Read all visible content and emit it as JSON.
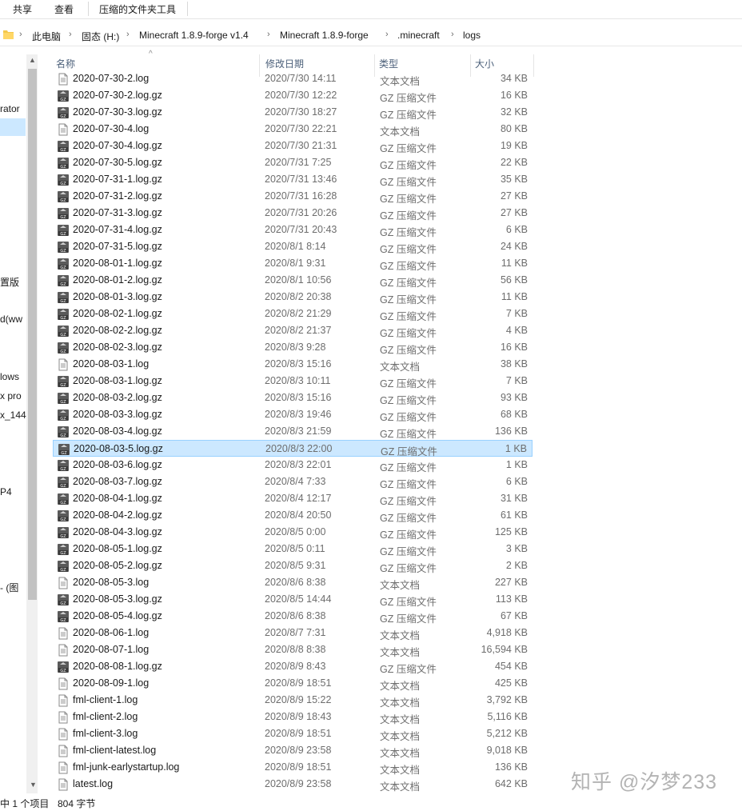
{
  "ribbon": {
    "tabs": [
      "共享",
      "查看",
      "压缩的文件夹工具"
    ]
  },
  "address": {
    "crumbs": [
      "此电脑",
      "固态 (H:)",
      "Minecraft 1.8.9-forge v1.4",
      "Minecraft 1.8.9-forge",
      ".minecraft",
      "logs"
    ]
  },
  "nav": {
    "fragments": [
      "rator",
      "置版",
      "d(ww",
      "lows",
      "x pro",
      "x_144",
      "P4",
      "- (图"
    ]
  },
  "columns": {
    "name": "名称",
    "date": "修改日期",
    "type": "类型",
    "size": "大小"
  },
  "files": [
    {
      "name": "2020-07-30-2.log",
      "date": "2020/7/30 14:11",
      "type": "文本文档",
      "size": "34 KB",
      "icon": "text-file-icon"
    },
    {
      "name": "2020-07-30-2.log.gz",
      "date": "2020/7/30 12:22",
      "type": "GZ 压缩文件",
      "size": "16 KB",
      "icon": "gz-file-icon"
    },
    {
      "name": "2020-07-30-3.log.gz",
      "date": "2020/7/30 18:27",
      "type": "GZ 压缩文件",
      "size": "32 KB",
      "icon": "gz-file-icon"
    },
    {
      "name": "2020-07-30-4.log",
      "date": "2020/7/30 22:21",
      "type": "文本文档",
      "size": "80 KB",
      "icon": "text-file-icon"
    },
    {
      "name": "2020-07-30-4.log.gz",
      "date": "2020/7/30 21:31",
      "type": "GZ 压缩文件",
      "size": "19 KB",
      "icon": "gz-file-icon"
    },
    {
      "name": "2020-07-30-5.log.gz",
      "date": "2020/7/31 7:25",
      "type": "GZ 压缩文件",
      "size": "22 KB",
      "icon": "gz-file-icon"
    },
    {
      "name": "2020-07-31-1.log.gz",
      "date": "2020/7/31 13:46",
      "type": "GZ 压缩文件",
      "size": "35 KB",
      "icon": "gz-file-icon"
    },
    {
      "name": "2020-07-31-2.log.gz",
      "date": "2020/7/31 16:28",
      "type": "GZ 压缩文件",
      "size": "27 KB",
      "icon": "gz-file-icon"
    },
    {
      "name": "2020-07-31-3.log.gz",
      "date": "2020/7/31 20:26",
      "type": "GZ 压缩文件",
      "size": "27 KB",
      "icon": "gz-file-icon"
    },
    {
      "name": "2020-07-31-4.log.gz",
      "date": "2020/7/31 20:43",
      "type": "GZ 压缩文件",
      "size": "6 KB",
      "icon": "gz-file-icon"
    },
    {
      "name": "2020-07-31-5.log.gz",
      "date": "2020/8/1 8:14",
      "type": "GZ 压缩文件",
      "size": "24 KB",
      "icon": "gz-file-icon"
    },
    {
      "name": "2020-08-01-1.log.gz",
      "date": "2020/8/1 9:31",
      "type": "GZ 压缩文件",
      "size": "11 KB",
      "icon": "gz-file-icon"
    },
    {
      "name": "2020-08-01-2.log.gz",
      "date": "2020/8/1 10:56",
      "type": "GZ 压缩文件",
      "size": "56 KB",
      "icon": "gz-file-icon"
    },
    {
      "name": "2020-08-01-3.log.gz",
      "date": "2020/8/2 20:38",
      "type": "GZ 压缩文件",
      "size": "11 KB",
      "icon": "gz-file-icon"
    },
    {
      "name": "2020-08-02-1.log.gz",
      "date": "2020/8/2 21:29",
      "type": "GZ 压缩文件",
      "size": "7 KB",
      "icon": "gz-file-icon"
    },
    {
      "name": "2020-08-02-2.log.gz",
      "date": "2020/8/2 21:37",
      "type": "GZ 压缩文件",
      "size": "4 KB",
      "icon": "gz-file-icon"
    },
    {
      "name": "2020-08-02-3.log.gz",
      "date": "2020/8/3 9:28",
      "type": "GZ 压缩文件",
      "size": "16 KB",
      "icon": "gz-file-icon"
    },
    {
      "name": "2020-08-03-1.log",
      "date": "2020/8/3 15:16",
      "type": "文本文档",
      "size": "38 KB",
      "icon": "text-file-icon"
    },
    {
      "name": "2020-08-03-1.log.gz",
      "date": "2020/8/3 10:11",
      "type": "GZ 压缩文件",
      "size": "7 KB",
      "icon": "gz-file-icon"
    },
    {
      "name": "2020-08-03-2.log.gz",
      "date": "2020/8/3 15:16",
      "type": "GZ 压缩文件",
      "size": "93 KB",
      "icon": "gz-file-icon"
    },
    {
      "name": "2020-08-03-3.log.gz",
      "date": "2020/8/3 19:46",
      "type": "GZ 压缩文件",
      "size": "68 KB",
      "icon": "gz-file-icon"
    },
    {
      "name": "2020-08-03-4.log.gz",
      "date": "2020/8/3 21:59",
      "type": "GZ 压缩文件",
      "size": "136 KB",
      "icon": "gz-file-icon"
    },
    {
      "name": "2020-08-03-5.log.gz",
      "date": "2020/8/3 22:00",
      "type": "GZ 压缩文件",
      "size": "1 KB",
      "icon": "gz-file-icon",
      "selected": true
    },
    {
      "name": "2020-08-03-6.log.gz",
      "date": "2020/8/3 22:01",
      "type": "GZ 压缩文件",
      "size": "1 KB",
      "icon": "gz-file-icon"
    },
    {
      "name": "2020-08-03-7.log.gz",
      "date": "2020/8/4 7:33",
      "type": "GZ 压缩文件",
      "size": "6 KB",
      "icon": "gz-file-icon"
    },
    {
      "name": "2020-08-04-1.log.gz",
      "date": "2020/8/4 12:17",
      "type": "GZ 压缩文件",
      "size": "31 KB",
      "icon": "gz-file-icon"
    },
    {
      "name": "2020-08-04-2.log.gz",
      "date": "2020/8/4 20:50",
      "type": "GZ 压缩文件",
      "size": "61 KB",
      "icon": "gz-file-icon"
    },
    {
      "name": "2020-08-04-3.log.gz",
      "date": "2020/8/5 0:00",
      "type": "GZ 压缩文件",
      "size": "125 KB",
      "icon": "gz-file-icon"
    },
    {
      "name": "2020-08-05-1.log.gz",
      "date": "2020/8/5 0:11",
      "type": "GZ 压缩文件",
      "size": "3 KB",
      "icon": "gz-file-icon"
    },
    {
      "name": "2020-08-05-2.log.gz",
      "date": "2020/8/5 9:31",
      "type": "GZ 压缩文件",
      "size": "2 KB",
      "icon": "gz-file-icon"
    },
    {
      "name": "2020-08-05-3.log",
      "date": "2020/8/6 8:38",
      "type": "文本文档",
      "size": "227 KB",
      "icon": "text-file-icon"
    },
    {
      "name": "2020-08-05-3.log.gz",
      "date": "2020/8/5 14:44",
      "type": "GZ 压缩文件",
      "size": "113 KB",
      "icon": "gz-file-icon"
    },
    {
      "name": "2020-08-05-4.log.gz",
      "date": "2020/8/6 8:38",
      "type": "GZ 压缩文件",
      "size": "67 KB",
      "icon": "gz-file-icon"
    },
    {
      "name": "2020-08-06-1.log",
      "date": "2020/8/7 7:31",
      "type": "文本文档",
      "size": "4,918 KB",
      "icon": "text-file-icon"
    },
    {
      "name": "2020-08-07-1.log",
      "date": "2020/8/8 8:38",
      "type": "文本文档",
      "size": "16,594 KB",
      "icon": "text-file-icon"
    },
    {
      "name": "2020-08-08-1.log.gz",
      "date": "2020/8/9 8:43",
      "type": "GZ 压缩文件",
      "size": "454 KB",
      "icon": "gz-file-icon"
    },
    {
      "name": "2020-08-09-1.log",
      "date": "2020/8/9 18:51",
      "type": "文本文档",
      "size": "425 KB",
      "icon": "text-file-icon"
    },
    {
      "name": "fml-client-1.log",
      "date": "2020/8/9 15:22",
      "type": "文本文档",
      "size": "3,792 KB",
      "icon": "text-file-icon"
    },
    {
      "name": "fml-client-2.log",
      "date": "2020/8/9 18:43",
      "type": "文本文档",
      "size": "5,116 KB",
      "icon": "text-file-icon"
    },
    {
      "name": "fml-client-3.log",
      "date": "2020/8/9 18:51",
      "type": "文本文档",
      "size": "5,212 KB",
      "icon": "text-file-icon"
    },
    {
      "name": "fml-client-latest.log",
      "date": "2020/8/9 23:58",
      "type": "文本文档",
      "size": "9,018 KB",
      "icon": "text-file-icon"
    },
    {
      "name": "fml-junk-earlystartup.log",
      "date": "2020/8/9 18:51",
      "type": "文本文档",
      "size": "136 KB",
      "icon": "text-file-icon"
    },
    {
      "name": "latest.log",
      "date": "2020/8/9 23:58",
      "type": "文本文档",
      "size": "642 KB",
      "icon": "text-file-icon"
    }
  ],
  "status": {
    "selection": "中 1 个项目",
    "size": "804 字节"
  },
  "watermark": "知乎 @汐梦233",
  "colors": {
    "selection_bg": "#cce8ff",
    "selection_border": "#99d1ff",
    "header_text": "#4c607a",
    "folder_yellow": "#f4c84c"
  }
}
